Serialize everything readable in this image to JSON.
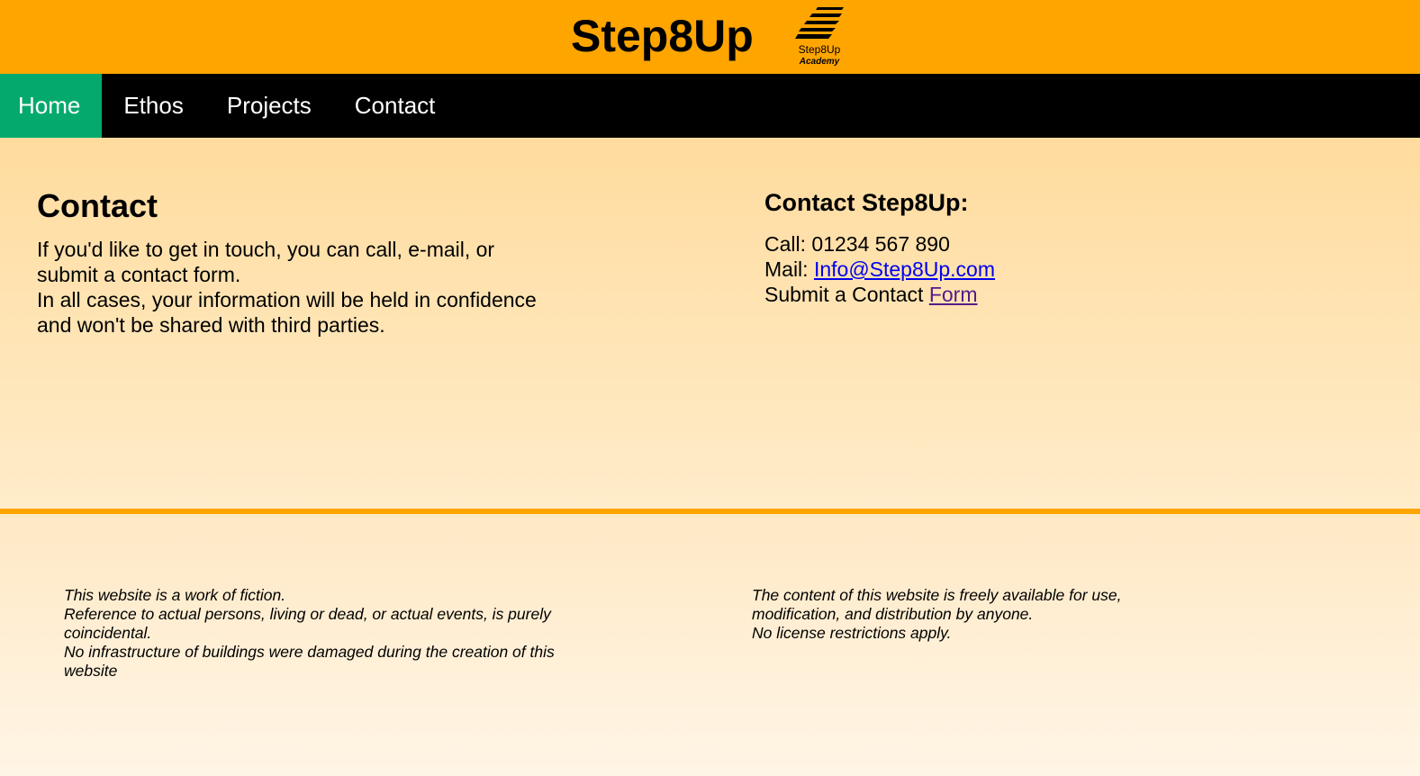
{
  "header": {
    "site_title": "Step8Up",
    "logo_line1": "Step8Up",
    "logo_line2": "Academy"
  },
  "nav": {
    "items": [
      {
        "label": "Home",
        "active": true
      },
      {
        "label": "Ethos",
        "active": false
      },
      {
        "label": "Projects",
        "active": false
      },
      {
        "label": "Contact",
        "active": false
      }
    ]
  },
  "main": {
    "heading": "Contact",
    "intro_lines": [
      "If you'd like to get in touch, you can call, e-mail, or",
      "submit a contact form.",
      "In all cases, your information will be held in confidence",
      "and won't be shared with third parties."
    ],
    "contact_heading": "Contact Step8Up:",
    "call_label": "Call: 01234 567 890",
    "mail_label": "Mail: ",
    "mail_link": "Info@Step8Up.com",
    "form_label": "Submit a Contact ",
    "form_link": "Form"
  },
  "footer": {
    "left_lines": [
      "This website is a work of fiction.",
      "Reference to actual persons, living or dead, or actual events, is purely",
      "coincidental.",
      "No infrastructure of buildings were damaged during the creation of this",
      "website"
    ],
    "right_lines": [
      "The content of this website is freely available for use,",
      "modification, and distribution by anyone.",
      "No license restrictions apply."
    ]
  },
  "colors": {
    "header_bg": "#ffa500",
    "nav_bg": "#000000",
    "nav_active": "#04aa6d",
    "link": "#0000ee",
    "visited_link": "#551a8b"
  }
}
